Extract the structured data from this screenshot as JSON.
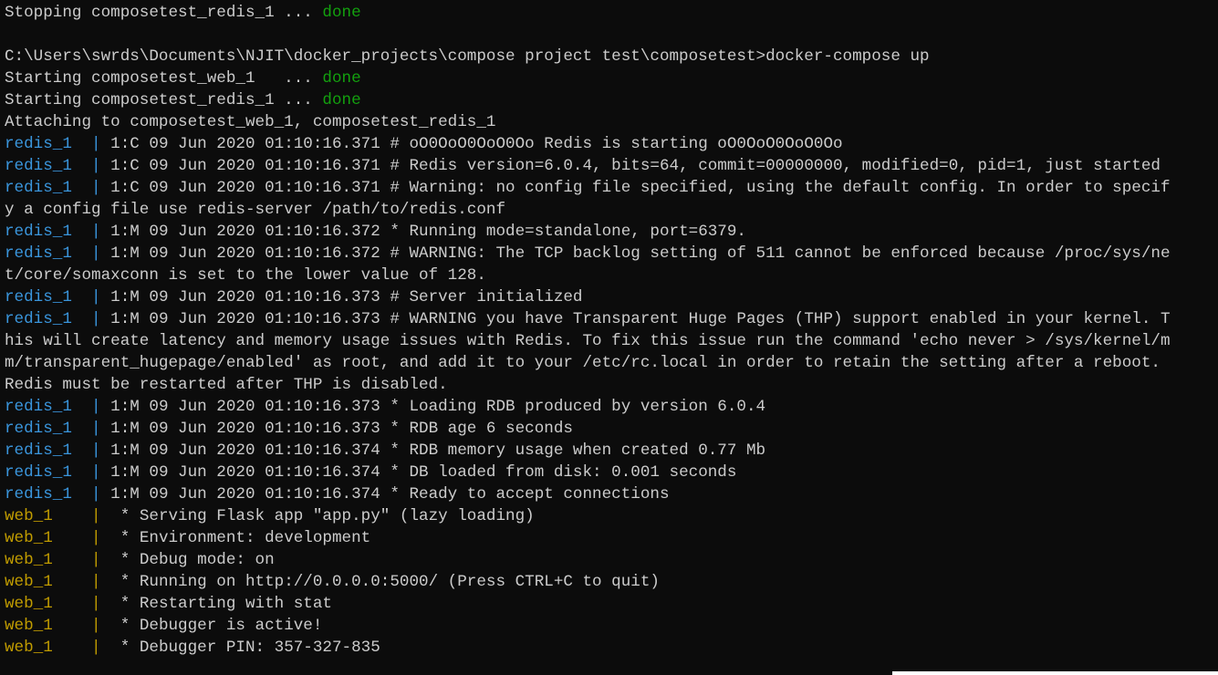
{
  "terminal": {
    "lines": [
      {
        "kind": "status",
        "text": "Stopping composetest_redis_1 ... ",
        "status": "done"
      },
      {
        "kind": "plain",
        "text": ""
      },
      {
        "kind": "plain",
        "text": "C:\\Users\\swrds\\Documents\\NJIT\\docker_projects\\compose project test\\composetest>docker-compose up"
      },
      {
        "kind": "status",
        "text": "Starting composetest_web_1   ... ",
        "status": "done"
      },
      {
        "kind": "status",
        "text": "Starting composetest_redis_1 ... ",
        "status": "done"
      },
      {
        "kind": "plain",
        "text": "Attaching to composetest_web_1, composetest_redis_1"
      },
      {
        "kind": "redis",
        "service": "redis_1",
        "pipe": "  |",
        "text": " 1:C 09 Jun 2020 01:10:16.371 # oO0OoO0OoO0Oo Redis is starting oO0OoO0OoO0Oo"
      },
      {
        "kind": "redis",
        "service": "redis_1",
        "pipe": "  |",
        "text": " 1:C 09 Jun 2020 01:10:16.371 # Redis version=6.0.4, bits=64, commit=00000000, modified=0, pid=1, just started"
      },
      {
        "kind": "redis",
        "service": "redis_1",
        "pipe": "  |",
        "text": " 1:C 09 Jun 2020 01:10:16.371 # Warning: no config file specified, using the default config. In order to specif"
      },
      {
        "kind": "plain",
        "text": "y a config file use redis-server /path/to/redis.conf"
      },
      {
        "kind": "redis",
        "service": "redis_1",
        "pipe": "  |",
        "text": " 1:M 09 Jun 2020 01:10:16.372 * Running mode=standalone, port=6379."
      },
      {
        "kind": "redis",
        "service": "redis_1",
        "pipe": "  |",
        "text": " 1:M 09 Jun 2020 01:10:16.372 # WARNING: The TCP backlog setting of 511 cannot be enforced because /proc/sys/ne"
      },
      {
        "kind": "plain",
        "text": "t/core/somaxconn is set to the lower value of 128."
      },
      {
        "kind": "redis",
        "service": "redis_1",
        "pipe": "  |",
        "text": " 1:M 09 Jun 2020 01:10:16.373 # Server initialized"
      },
      {
        "kind": "redis",
        "service": "redis_1",
        "pipe": "  |",
        "text": " 1:M 09 Jun 2020 01:10:16.373 # WARNING you have Transparent Huge Pages (THP) support enabled in your kernel. T"
      },
      {
        "kind": "plain",
        "text": "his will create latency and memory usage issues with Redis. To fix this issue run the command 'echo never > /sys/kernel/m"
      },
      {
        "kind": "plain",
        "text": "m/transparent_hugepage/enabled' as root, and add it to your /etc/rc.local in order to retain the setting after a reboot."
      },
      {
        "kind": "plain",
        "text": "Redis must be restarted after THP is disabled."
      },
      {
        "kind": "redis",
        "service": "redis_1",
        "pipe": "  |",
        "text": " 1:M 09 Jun 2020 01:10:16.373 * Loading RDB produced by version 6.0.4"
      },
      {
        "kind": "redis",
        "service": "redis_1",
        "pipe": "  |",
        "text": " 1:M 09 Jun 2020 01:10:16.373 * RDB age 6 seconds"
      },
      {
        "kind": "redis",
        "service": "redis_1",
        "pipe": "  |",
        "text": " 1:M 09 Jun 2020 01:10:16.374 * RDB memory usage when created 0.77 Mb"
      },
      {
        "kind": "redis",
        "service": "redis_1",
        "pipe": "  |",
        "text": " 1:M 09 Jun 2020 01:10:16.374 * DB loaded from disk: 0.001 seconds"
      },
      {
        "kind": "redis",
        "service": "redis_1",
        "pipe": "  |",
        "text": " 1:M 09 Jun 2020 01:10:16.374 * Ready to accept connections"
      },
      {
        "kind": "web",
        "service": "web_1",
        "pipe": "    |",
        "text": "  * Serving Flask app \"app.py\" (lazy loading)"
      },
      {
        "kind": "web",
        "service": "web_1",
        "pipe": "    |",
        "text": "  * Environment: development"
      },
      {
        "kind": "web",
        "service": "web_1",
        "pipe": "    |",
        "text": "  * Debug mode: on"
      },
      {
        "kind": "web",
        "service": "web_1",
        "pipe": "    |",
        "text": "  * Running on http://0.0.0.0:5000/ (Press CTRL+C to quit)"
      },
      {
        "kind": "web",
        "service": "web_1",
        "pipe": "    |",
        "text": "  * Restarting with stat"
      },
      {
        "kind": "web",
        "service": "web_1",
        "pipe": "    |",
        "text": "  * Debugger is active!"
      },
      {
        "kind": "web",
        "service": "web_1",
        "pipe": "    |",
        "text": "  * Debugger PIN: 357-327-835"
      }
    ]
  },
  "colors": {
    "background": "#0c0c0c",
    "text": "#cccccc",
    "done": "#13a10e",
    "redis_service": "#3a96dd",
    "web_service": "#c19c00"
  }
}
